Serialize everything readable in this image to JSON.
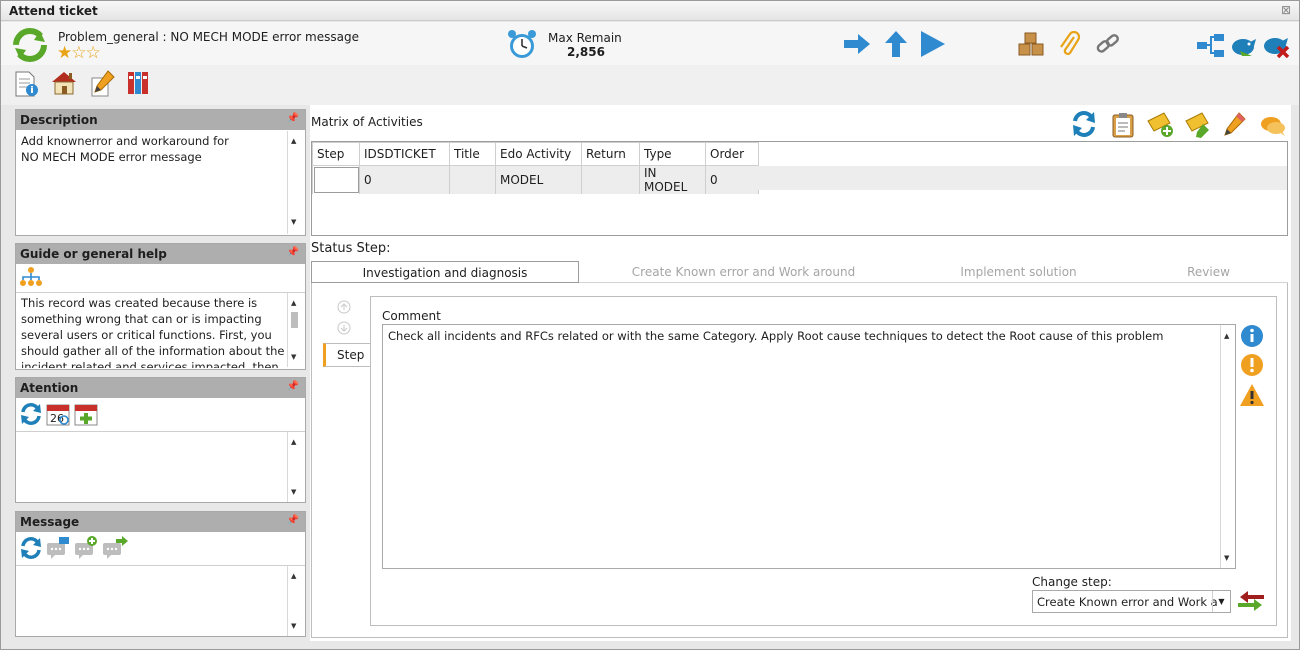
{
  "window": {
    "title": "Attend ticket",
    "close_glyph": "⊠"
  },
  "header": {
    "ticket_title": "Problem_general : NO MECH MODE error message",
    "rating": 1,
    "rating_max": 3,
    "remain_label": "Max Remain",
    "remain_value": "2,856"
  },
  "panels": {
    "description": {
      "title": "Description",
      "text": "Add knownerror and workaround for\nNO MECH MODE error message"
    },
    "guide": {
      "title": "Guide or general help",
      "text": "This record was created because there is something wrong that can or is impacting several users or critical functions. First, you should gather all of the information about the incident related and services impacted, then"
    },
    "attention": {
      "title": "Atention"
    },
    "message": {
      "title": "Message"
    },
    "pin_glyph": "📌"
  },
  "matrix": {
    "title": "Matrix of Activities",
    "columns": [
      "Step",
      "IDSDTICKET",
      "Title",
      "Edo Activity",
      "Return",
      "Type",
      "Order"
    ],
    "rows": [
      [
        "",
        "0",
        "",
        "MODEL",
        "",
        "IN MODEL",
        "0"
      ]
    ]
  },
  "status": {
    "label": "Status Step:",
    "tabs": [
      "Investigation and diagnosis",
      "Create Known error and Work around",
      "Implement solution",
      "Review"
    ],
    "active_tab": 0
  },
  "step": {
    "side_tab": "Step",
    "comment_label": "Comment",
    "comment_text": "Check all incidents and RFCs related or with the same Category. Apply Root cause techniques to detect the Root cause of this problem",
    "change_label": "Change step:",
    "change_value": "Create Known error and Work a"
  },
  "icons": [
    "refresh-icon",
    "alarm-clock-icon",
    "arrow-right-icon",
    "arrow-up-icon",
    "play-icon",
    "boxes-icon",
    "paperclip-icon",
    "link-icon",
    "hierarchy-icon",
    "bird-icon",
    "close-bird-icon",
    "document-info-icon",
    "home-icon",
    "edit-icon",
    "binders-icon",
    "clipboard-icon",
    "ticket-add-icon",
    "ticket-edit-icon",
    "pencil-icon",
    "chat-icon",
    "org-chart-icon",
    "calendar-icon",
    "calendar-add-icon",
    "message-icon",
    "message-add-icon",
    "message-forward-icon",
    "info-icon",
    "exclamation-icon",
    "warning-icon",
    "swap-arrows-icon",
    "arrow-circle-up-icon",
    "arrow-circle-down-icon",
    "star-icon"
  ],
  "colors": {
    "panel_header": "#aeaeae",
    "accent_blue": "#2f8ad0",
    "orange": "#f0a020",
    "green": "#5aa82a"
  }
}
